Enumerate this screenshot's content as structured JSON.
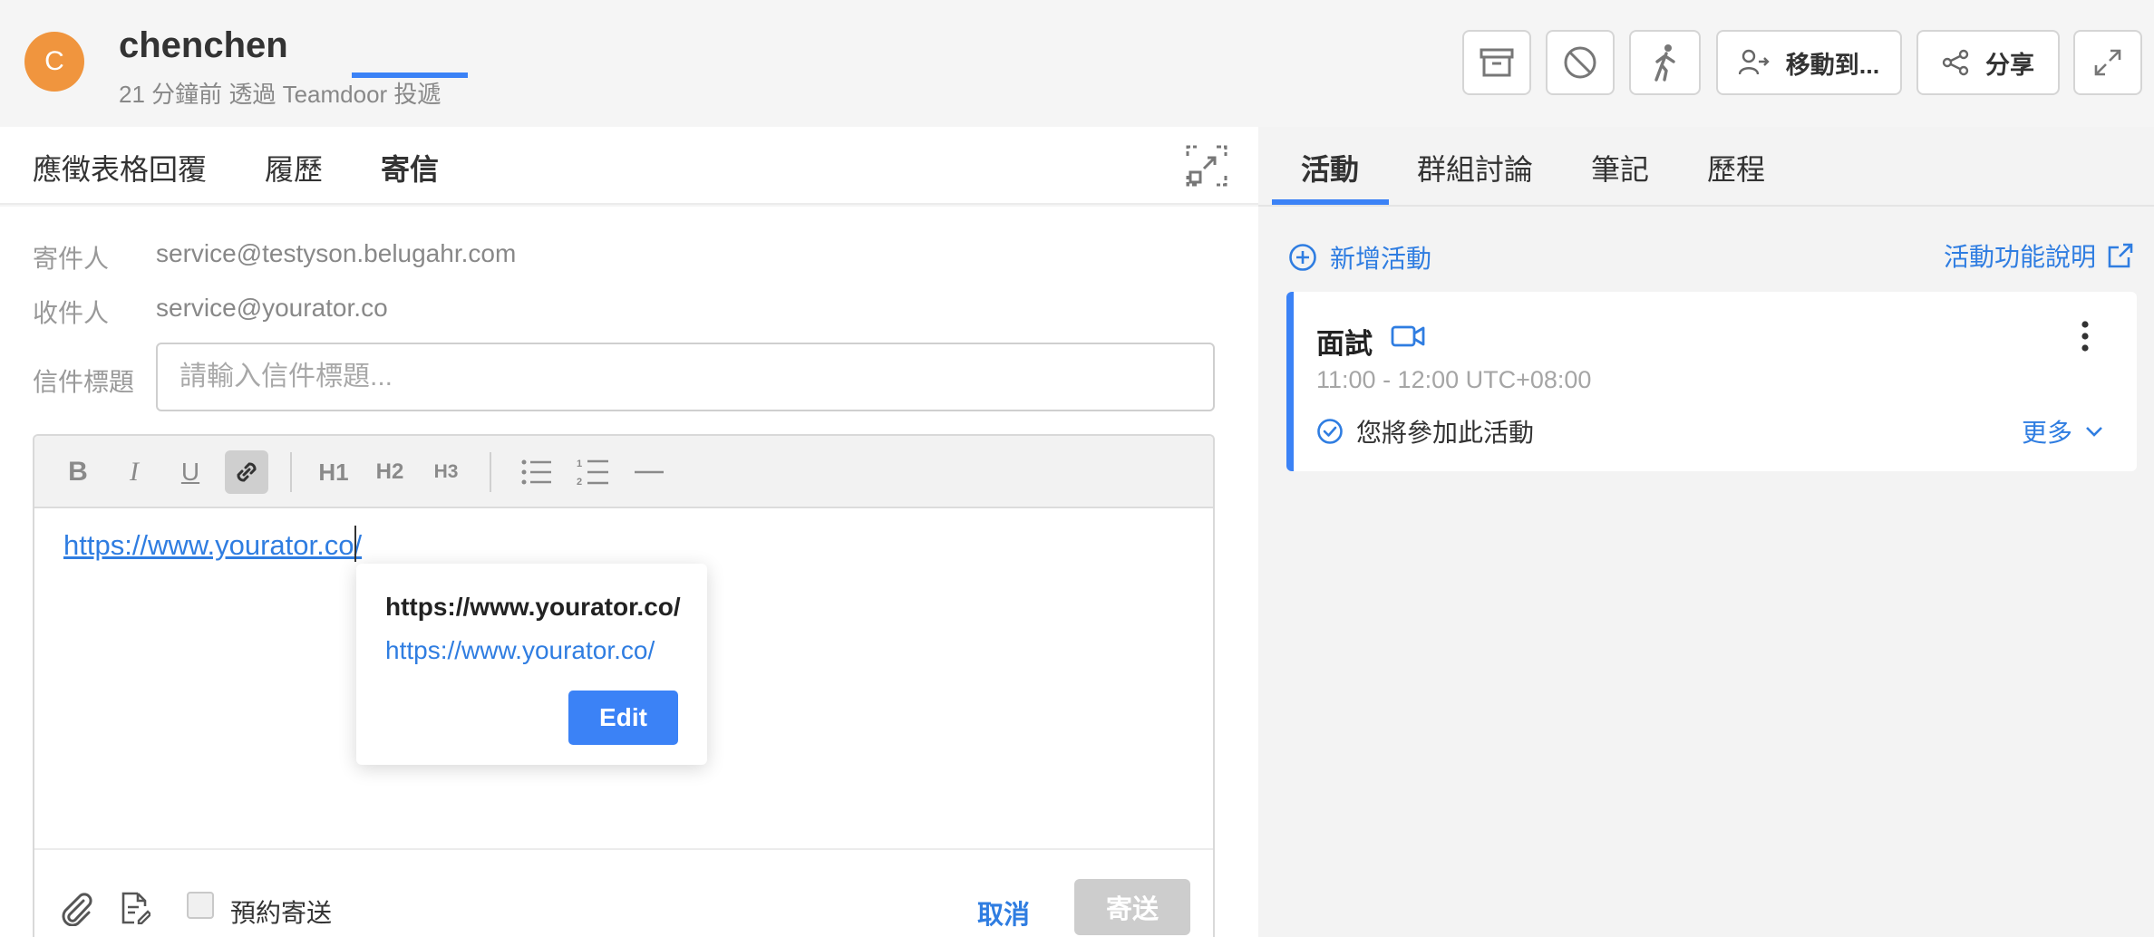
{
  "candidate": {
    "avatar_letter": "C",
    "name": "chenchen",
    "subtitle": "21 分鐘前 透過 Teamdoor 投遞"
  },
  "header_actions": {
    "archive_icon": "archive-icon",
    "block_icon": "block-icon",
    "walk_icon": "walking-person-icon",
    "move_label": "移動到...",
    "share_label": "分享",
    "expand_icon": "expand-icon"
  },
  "left_tabs": [
    {
      "label": "應徵表格回覆",
      "active": false
    },
    {
      "label": "履歷",
      "active": false
    },
    {
      "label": "寄信",
      "active": true
    }
  ],
  "email": {
    "from_label": "寄件人",
    "from_value": "service@testyson.belugahr.com",
    "to_label": "收件人",
    "to_value": "service@yourator.co",
    "subject_label": "信件標題",
    "subject_placeholder": "請輸入信件標題...",
    "subject_value": ""
  },
  "toolbar": {
    "bold": "B",
    "italic": "I",
    "underline": "U",
    "h1": "H1",
    "h2": "H2",
    "h3": "H3",
    "link_active": true
  },
  "editor": {
    "body_link": "https://www.yourator.co/"
  },
  "link_popover": {
    "title": "https://www.yourator.co/",
    "url": "https://www.yourator.co/",
    "edit_label": "Edit"
  },
  "compose_footer": {
    "schedule_label": "預約寄送",
    "schedule_checked": false,
    "cancel_label": "取消",
    "send_label": "寄送"
  },
  "right_tabs": [
    {
      "label": "活動",
      "active": true
    },
    {
      "label": "群組討論",
      "active": false
    },
    {
      "label": "筆記",
      "active": false
    },
    {
      "label": "歷程",
      "active": false
    }
  ],
  "activity_panel": {
    "add_label": "新增活動",
    "help_label": "活動功能說明"
  },
  "activity": {
    "title": "面試",
    "time": "11:00 - 12:00 UTC+08:00",
    "status": "您將參加此活動",
    "more_label": "更多"
  },
  "colors": {
    "accent": "#3b82f6",
    "link": "#2f7de1",
    "avatar": "#f0953e"
  }
}
